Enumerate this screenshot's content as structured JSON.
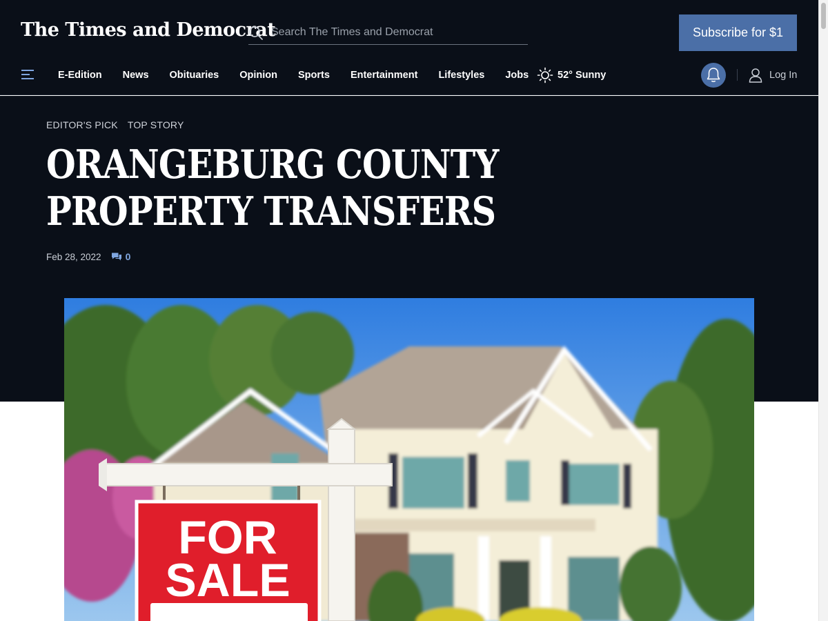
{
  "header": {
    "logo": "The Times and Democrat",
    "search_placeholder": "Search The Times and Democrat",
    "subscribe_label": "Subscribe for $1"
  },
  "nav": {
    "items": [
      "E-Edition",
      "News",
      "Obituaries",
      "Opinion",
      "Sports",
      "Entertainment",
      "Lifestyles",
      "Jobs"
    ],
    "weather": "52° Sunny",
    "login_label": "Log In"
  },
  "article": {
    "tags": [
      "EDITOR'S PICK",
      "TOP STORY"
    ],
    "headline": "ORANGEBURG COUNTY PROPERTY TRANSFERS",
    "date": "Feb 28, 2022",
    "comment_count": "0"
  },
  "photo": {
    "sign_line1": "FOR",
    "sign_line2": "SALE"
  },
  "colors": {
    "header_bg": "#0a0f18",
    "accent": "#4b6fa7",
    "comment_link": "#7fa6e0",
    "sign_red": "#e01e2b"
  },
  "icons": [
    "search-icon",
    "hamburger-menu-icon",
    "sun-icon",
    "bell-icon",
    "user-icon",
    "comment-icon"
  ]
}
